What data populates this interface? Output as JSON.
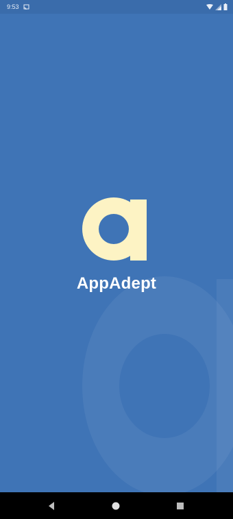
{
  "status_bar": {
    "time": "9:53",
    "icons": [
      "cast-icon",
      "wifi-icon",
      "cellular-icon",
      "battery-icon"
    ]
  },
  "splash": {
    "app_name": "AppAdept",
    "logo_glyph": "a",
    "colors": {
      "background": "#3f74b6",
      "logo": "#fdf3c4",
      "text": "#ffffff"
    }
  },
  "nav_bar": {
    "buttons": [
      "back",
      "home",
      "recents"
    ]
  }
}
